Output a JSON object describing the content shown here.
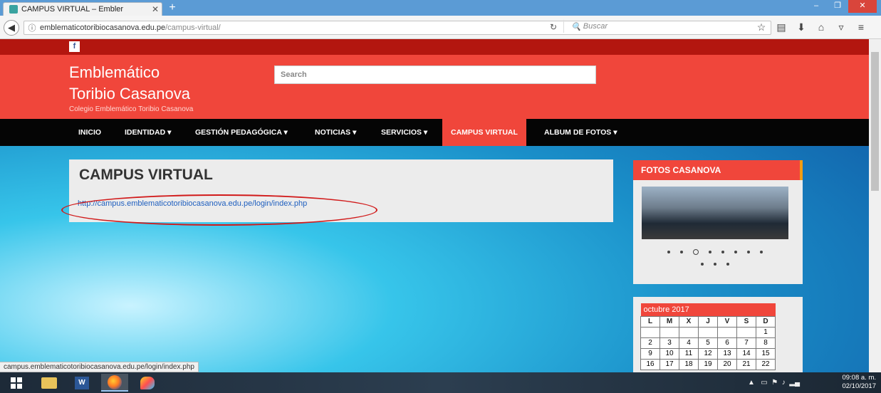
{
  "browser": {
    "tab_title": "CAMPUS VIRTUAL – Embler",
    "tab_close": "✕",
    "new_tab": "+",
    "url_host": "emblematicotoribiocasanova.edu.pe",
    "url_path": "/campus-virtual/",
    "search_placeholder": "Buscar",
    "window_buttons": [
      "–",
      "❐",
      "✕"
    ]
  },
  "site": {
    "facebook_label": "f",
    "brand_line1": "Emblemático",
    "brand_line2": "Toribio Casanova",
    "tagline": "Colegio Emblemático Toribio Casanova",
    "search_placeholder": "Search",
    "menu": [
      "INICIO",
      "IDENTIDAD ▾",
      "GESTIÓN PEDAGÓGICA ▾",
      "NOTICIAS ▾",
      "SERVICIOS ▾",
      "CAMPUS VIRTUAL",
      "ALBUM DE FOTOS ▾"
    ],
    "active_menu": "CAMPUS VIRTUAL"
  },
  "content": {
    "heading": "CAMPUS VIRTUAL",
    "link": "http://campus.emblematicotoribiocasanova.edu.pe/login/index.php"
  },
  "sidebar": {
    "photos_title": "FOTOS CASANOVA",
    "calendar": {
      "month": "octubre 2017",
      "weekdays": [
        "L",
        "M",
        "X",
        "J",
        "V",
        "S",
        "D"
      ],
      "weeks": [
        [
          "",
          "",
          "",
          "",
          "",
          "",
          "1"
        ],
        [
          "2",
          "3",
          "4",
          "5",
          "6",
          "7",
          "8"
        ],
        [
          "9",
          "10",
          "11",
          "12",
          "13",
          "14",
          "15"
        ],
        [
          "16",
          "17",
          "18",
          "19",
          "20",
          "21",
          "22"
        ]
      ]
    }
  },
  "status_bar_url": "campus.emblematicotoribiocasanova.edu.pe/login/index.php",
  "taskbar": {
    "time": "09:08 a. m.",
    "date": "02/10/2017"
  },
  "colors": {
    "site_red": "#f0463b",
    "dark_red": "#b3160f",
    "menu_black": "#050505",
    "highlight_oval": "#d11a1a"
  }
}
